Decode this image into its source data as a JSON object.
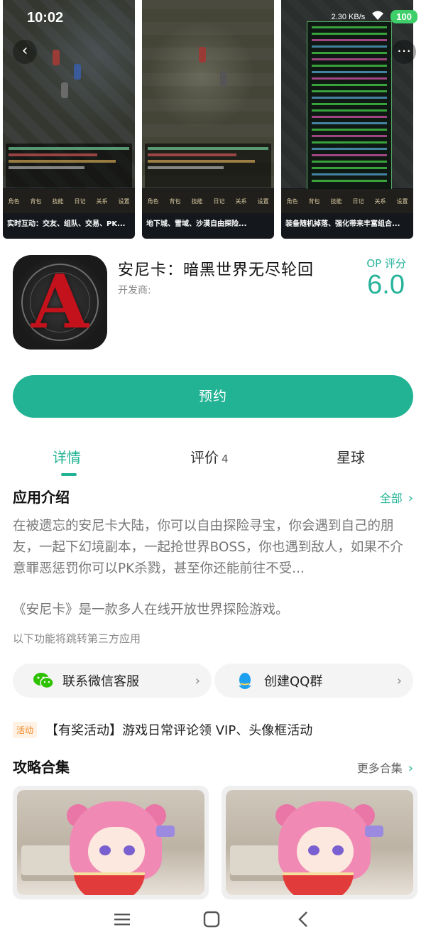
{
  "status_bar": {
    "time": "10:02",
    "network_speed": "2.30 KB/s",
    "battery": "100"
  },
  "gallery": {
    "screenshots": [
      {
        "caption": "实时互动：交友、组队、交易、PK...",
        "menu": [
          "角色",
          "背包",
          "技能",
          "日记",
          "关系",
          "设置"
        ]
      },
      {
        "caption": "地下城、雪域、沙漠自由探险...",
        "menu": [
          "角色",
          "背包",
          "技能",
          "日记",
          "关系",
          "设置"
        ]
      },
      {
        "caption": "装备随机掉落、强化带来丰富组合...",
        "menu": [
          "角色",
          "背包",
          "技能",
          "日记",
          "关系",
          "设置"
        ]
      }
    ]
  },
  "app": {
    "title": "安尼卡：暗黑世界无尽轮回",
    "developer_label": "开发商:",
    "rating_label": "OP 评分",
    "rating_value": "6.0",
    "icon_letter": "A"
  },
  "actions": {
    "reserve": "预约"
  },
  "tabs": {
    "detail": "详情",
    "review": "评价",
    "review_count": "4",
    "planet": "星球"
  },
  "intro": {
    "title": "应用介绍",
    "all_link": "全部",
    "paragraph": "在被遗忘的安尼卡大陆，你可以自由探险寻宝，你会遇到自己的朋友，一起下幻境副本，一起抢世界BOSS，你也遇到敌人，如果不介意罪恶惩罚你可以PK杀戮，甚至你还能前往不受...",
    "summary": "《安尼卡》是一款多人在线开放世界探险游戏。",
    "third_party_note": "以下功能将跳转第三方应用"
  },
  "links": {
    "wechat": "联系微信客服",
    "qq": "创建QQ群"
  },
  "activity": {
    "badge": "活动",
    "text": "【有奖活动】游戏日常评论领 VIP、头像框活动"
  },
  "guides": {
    "title": "攻略合集",
    "more": "更多合集"
  },
  "colors": {
    "accent": "#22b394",
    "activity_badge_text": "#f08a2a",
    "icon_red": "#c4121c"
  },
  "icons": [
    "back-icon",
    "more-icon",
    "wechat-icon",
    "qq-icon",
    "chevron-right-icon",
    "menu-icon",
    "home-icon",
    "nav-back-icon"
  ]
}
